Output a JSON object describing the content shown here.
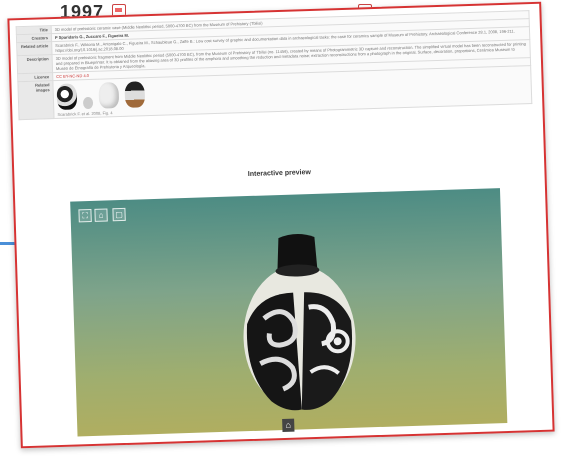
{
  "background": {
    "year": "1997"
  },
  "record": {
    "rows": [
      {
        "key": "Title",
        "value": "3D model of prehistoric ceramic vase (Middle Neolithic period, 5000-4700 BC) from the Museum of Prehistory (Tbilisi)",
        "style": "normal"
      },
      {
        "key": "Creators",
        "value": "P Sparidaris G., Zuccaro F., Figueira M.",
        "style": "strong"
      },
      {
        "key": "Related article",
        "value": "Scarabrick F., Wiktoria M., Antonigalo C., Figueira M., Schaubleue G., Zaffe B.: Low cost survey of graphic and documentation data in archaeological tasks: the case for ceramics sample of Museum of Prehistory. Archaeological Conference 28.1, 2008, 196-211. https://doi.org/10.1016/j.ac.2018.08.00",
        "style": "normal"
      },
      {
        "key": "Description",
        "value": "3D model of prehistoric fragment from Middle Neolithic period (5000-4700 BC), from the Museum of Prehistory of Tbilisi (no. 11456), created by means of Photogrammetric 3D capture and reconstruction. The simplified virtual model has been reconstructed for printing and prepared in Blueprinter. It is obtained from the aliasing area of 3D profiles of the amphora and smoothing the reduction and metadata noise; extraction reconstructions from a photograph in the original. Surface, decoration, proportions, Cerámica Museum to Museo de Etnografía de Prehistoria y Arqueología.",
        "style": "normal"
      },
      {
        "key": "Licence",
        "value": "CC BY-NC-ND 4.0",
        "style": "red"
      }
    ],
    "related_images_key": "Related images",
    "related_images_caption": "Scarabrick F. et al. 2008, Fig. 4"
  },
  "preview": {
    "title": "Interactive preview",
    "buttons": [
      {
        "name": "fullscreen-button",
        "icon": "fullscreen-icon",
        "glyph": "⛶"
      },
      {
        "name": "vr-button",
        "icon": "vr-headset-icon",
        "glyph": "⌂"
      },
      {
        "name": "frame-button",
        "icon": "frame-icon",
        "glyph": "▢"
      }
    ],
    "home_icon": "home-icon"
  }
}
